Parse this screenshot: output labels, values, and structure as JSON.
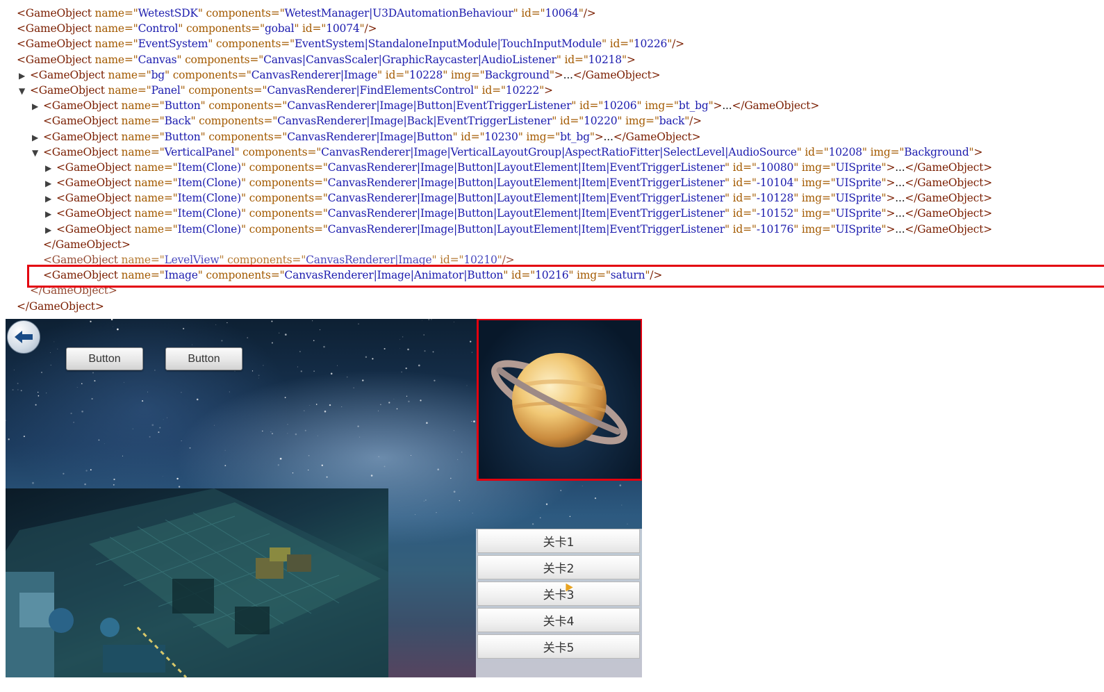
{
  "tree": {
    "lines": [
      {
        "indent": 0,
        "toggle": "",
        "tag": "GameObject",
        "attrs": [
          [
            "name",
            "WetestSDK"
          ],
          [
            "components",
            "WetestManager|U3DAutomationBehaviour"
          ],
          [
            "id",
            "10064"
          ]
        ],
        "selfclose": true
      },
      {
        "indent": 0,
        "toggle": "",
        "tag": "GameObject",
        "attrs": [
          [
            "name",
            "Control"
          ],
          [
            "components",
            "gobal"
          ],
          [
            "id",
            "10074"
          ]
        ],
        "selfclose": true
      },
      {
        "indent": 0,
        "toggle": "",
        "tag": "GameObject",
        "attrs": [
          [
            "name",
            "EventSystem"
          ],
          [
            "components",
            "EventSystem|StandaloneInputModule|TouchInputModule"
          ],
          [
            "id",
            "10226"
          ]
        ],
        "selfclose": true
      },
      {
        "indent": 0,
        "toggle": "",
        "tag": "GameObject",
        "attrs": [
          [
            "name",
            "Canvas"
          ],
          [
            "components",
            "Canvas|CanvasScaler|GraphicRaycaster|AudioListener"
          ],
          [
            "id",
            "10218"
          ]
        ],
        "open": true
      },
      {
        "indent": 1,
        "toggle": "▶",
        "tag": "GameObject",
        "attrs": [
          [
            "name",
            "bg"
          ],
          [
            "components",
            "CanvasRenderer|Image"
          ],
          [
            "id",
            "10228"
          ],
          [
            "img",
            "Background"
          ]
        ],
        "collapsed": true
      },
      {
        "indent": 1,
        "toggle": "▼",
        "tag": "GameObject",
        "attrs": [
          [
            "name",
            "Panel"
          ],
          [
            "components",
            "CanvasRenderer|FindElementsControl"
          ],
          [
            "id",
            "10222"
          ]
        ],
        "open": true
      },
      {
        "indent": 2,
        "toggle": "▶",
        "tag": "GameObject",
        "attrs": [
          [
            "name",
            "Button"
          ],
          [
            "components",
            "CanvasRenderer|Image|Button|EventTriggerListener"
          ],
          [
            "id",
            "10206"
          ],
          [
            "img",
            "bt_bg"
          ]
        ],
        "collapsed": true
      },
      {
        "indent": 2,
        "toggle": "",
        "tag": "GameObject",
        "attrs": [
          [
            "name",
            "Back"
          ],
          [
            "components",
            "CanvasRenderer|Image|Back|EventTriggerListener"
          ],
          [
            "id",
            "10220"
          ],
          [
            "img",
            "back"
          ]
        ],
        "selfclose": true
      },
      {
        "indent": 2,
        "toggle": "▶",
        "tag": "GameObject",
        "attrs": [
          [
            "name",
            "Button"
          ],
          [
            "components",
            "CanvasRenderer|Image|Button"
          ],
          [
            "id",
            "10230"
          ],
          [
            "img",
            "bt_bg"
          ]
        ],
        "collapsed": true
      },
      {
        "indent": 2,
        "toggle": "▼",
        "tag": "GameObject",
        "attrs": [
          [
            "name",
            "VerticalPanel"
          ],
          [
            "components",
            "CanvasRenderer|Image|VerticalLayoutGroup|AspectRatioFitter|SelectLevel|AudioSource"
          ],
          [
            "id",
            "10208"
          ],
          [
            "img",
            "Background"
          ]
        ],
        "open": true
      },
      {
        "indent": 3,
        "toggle": "▶",
        "tag": "GameObject",
        "attrs": [
          [
            "name",
            "Item(Clone)"
          ],
          [
            "components",
            "CanvasRenderer|Image|Button|LayoutElement|Item|EventTriggerListener"
          ],
          [
            "id",
            "-10080"
          ],
          [
            "img",
            "UISprite"
          ]
        ],
        "collapsed": true
      },
      {
        "indent": 3,
        "toggle": "▶",
        "tag": "GameObject",
        "attrs": [
          [
            "name",
            "Item(Clone)"
          ],
          [
            "components",
            "CanvasRenderer|Image|Button|LayoutElement|Item|EventTriggerListener"
          ],
          [
            "id",
            "-10104"
          ],
          [
            "img",
            "UISprite"
          ]
        ],
        "collapsed": true
      },
      {
        "indent": 3,
        "toggle": "▶",
        "tag": "GameObject",
        "attrs": [
          [
            "name",
            "Item(Clone)"
          ],
          [
            "components",
            "CanvasRenderer|Image|Button|LayoutElement|Item|EventTriggerListener"
          ],
          [
            "id",
            "-10128"
          ],
          [
            "img",
            "UISprite"
          ]
        ],
        "collapsed": true
      },
      {
        "indent": 3,
        "toggle": "▶",
        "tag": "GameObject",
        "attrs": [
          [
            "name",
            "Item(Clone)"
          ],
          [
            "components",
            "CanvasRenderer|Image|Button|LayoutElement|Item|EventTriggerListener"
          ],
          [
            "id",
            "-10152"
          ],
          [
            "img",
            "UISprite"
          ]
        ],
        "collapsed": true
      },
      {
        "indent": 3,
        "toggle": "▶",
        "tag": "GameObject",
        "attrs": [
          [
            "name",
            "Item(Clone)"
          ],
          [
            "components",
            "CanvasRenderer|Image|Button|LayoutElement|Item|EventTriggerListener"
          ],
          [
            "id",
            "-10176"
          ],
          [
            "img",
            "UISprite"
          ]
        ],
        "collapsed": true
      },
      {
        "indent": 2,
        "toggle": "",
        "tag": "GameObject",
        "close": true
      },
      {
        "indent": 2,
        "toggle": "",
        "tag": "GameObject",
        "attrs": [
          [
            "name",
            "LevelView"
          ],
          [
            "components",
            "CanvasRenderer|Image"
          ],
          [
            "id",
            "10210"
          ]
        ],
        "selfclose": true,
        "faded": true
      },
      {
        "indent": 2,
        "toggle": "",
        "tag": "GameObject",
        "attrs": [
          [
            "name",
            "Image"
          ],
          [
            "components",
            "CanvasRenderer|Image|Animator|Button"
          ],
          [
            "id",
            "10216"
          ],
          [
            "img",
            "saturn"
          ]
        ],
        "selfclose": true,
        "highlighted": true
      },
      {
        "indent": 1,
        "toggle": "",
        "tag": "GameObject",
        "close": true,
        "faded": true
      },
      {
        "indent": 0,
        "toggle": "",
        "tag": "GameObject",
        "close": true
      }
    ],
    "ellipsis": "...",
    "highlight_color": "#e3000f"
  },
  "game": {
    "buttons": [
      "Button",
      "Button"
    ],
    "back_icon": "back-arrow-icon",
    "planet_icon": "saturn-icon",
    "levels": [
      "关卡1",
      "关卡2",
      "关卡3",
      "关卡4",
      "关卡5"
    ]
  }
}
